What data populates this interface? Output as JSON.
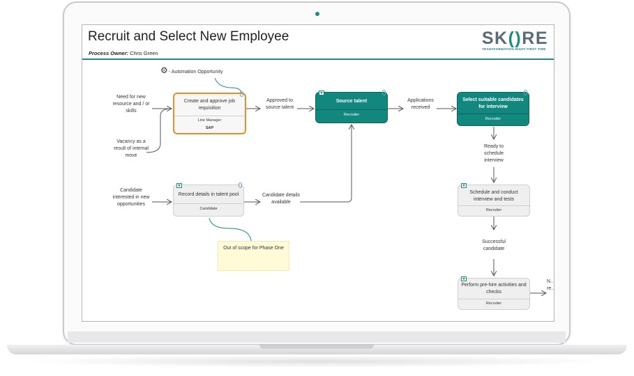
{
  "page": {
    "title": "Recruit and Select New Employee",
    "owner_label": "Process Owner:",
    "owner_name": "Chris Green"
  },
  "logo": {
    "word_part1": "SK",
    "word_o": "()",
    "word_part2": "RE",
    "tagline": "TRANSFORMATION RIGHT FIRST TIME"
  },
  "legend": {
    "automation_text": "- Automation Opportunity",
    "icon": "gears-icon"
  },
  "inputs": {
    "need_new_resource": "Need for new resource and / or skills",
    "vacancy_internal": "Vacancy as a result of internal move",
    "candidate_interested": "Candidate interested in new opportunities"
  },
  "activities": {
    "create_requisition": {
      "title": "Create and approve job requisition",
      "role": "Line Manager",
      "system": "SAP"
    },
    "record_talent_pool": {
      "title": "Record details in talent pool",
      "role": "Candidate"
    },
    "source_talent": {
      "title": "Source talent",
      "role": "Recruiter"
    },
    "select_candidates": {
      "title": "Select suitable candidates for interview",
      "role": "Recruiter"
    },
    "schedule_interview": {
      "title": "Schedule and conduct interview and tests",
      "role": "Recruiter"
    },
    "pre_hire": {
      "title": "Perform pre-hire activities and checks",
      "role": "Recruiter"
    }
  },
  "flows": {
    "approved_to_source": "Approved to source talent",
    "applications_received": "Applications received",
    "candidate_details": "Candidate details available",
    "ready_to_schedule": "Ready to schedule interview",
    "successful_candidate": "Successful candidate",
    "cut_off_label": "N…\nre…"
  },
  "notes": {
    "out_of_scope": "Out of scope for Phase One"
  },
  "colors": {
    "teal": "#11877d",
    "orange": "#f08a24",
    "note_yellow": "#fffad8"
  }
}
